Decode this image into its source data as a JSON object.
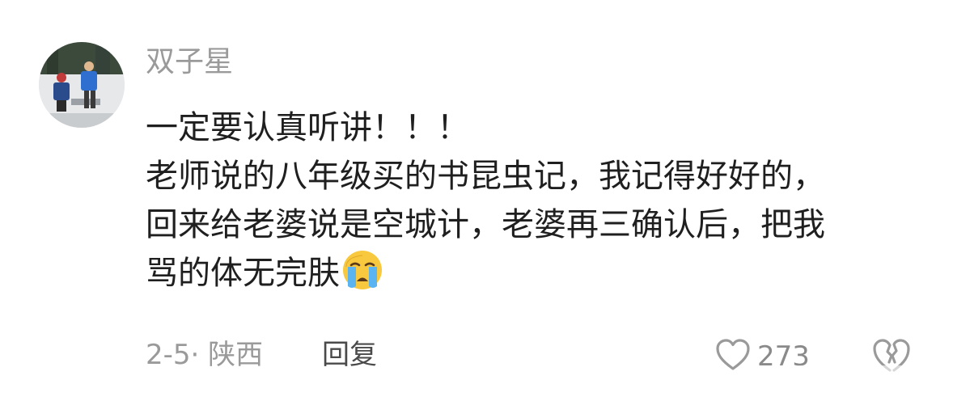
{
  "comment": {
    "username": "双子星",
    "lines": [
      "一定要认真听讲！！！",
      "老师说的八年级买的书昆虫记，我记得好好的，",
      "回来给老婆说是空城计，老婆再三确认后，把我",
      "骂的体无完肤"
    ],
    "emoji": "crying-face-icon",
    "meta": "2-5· 陕西",
    "reply_label": "回复",
    "like_count": "273"
  },
  "colors": {
    "text": "#1f1f1f",
    "secondary": "#9a9a9a",
    "reply": "#4a4a4a",
    "emoji_face": "#f8c93e",
    "emoji_tears": "#5ab4f2"
  }
}
